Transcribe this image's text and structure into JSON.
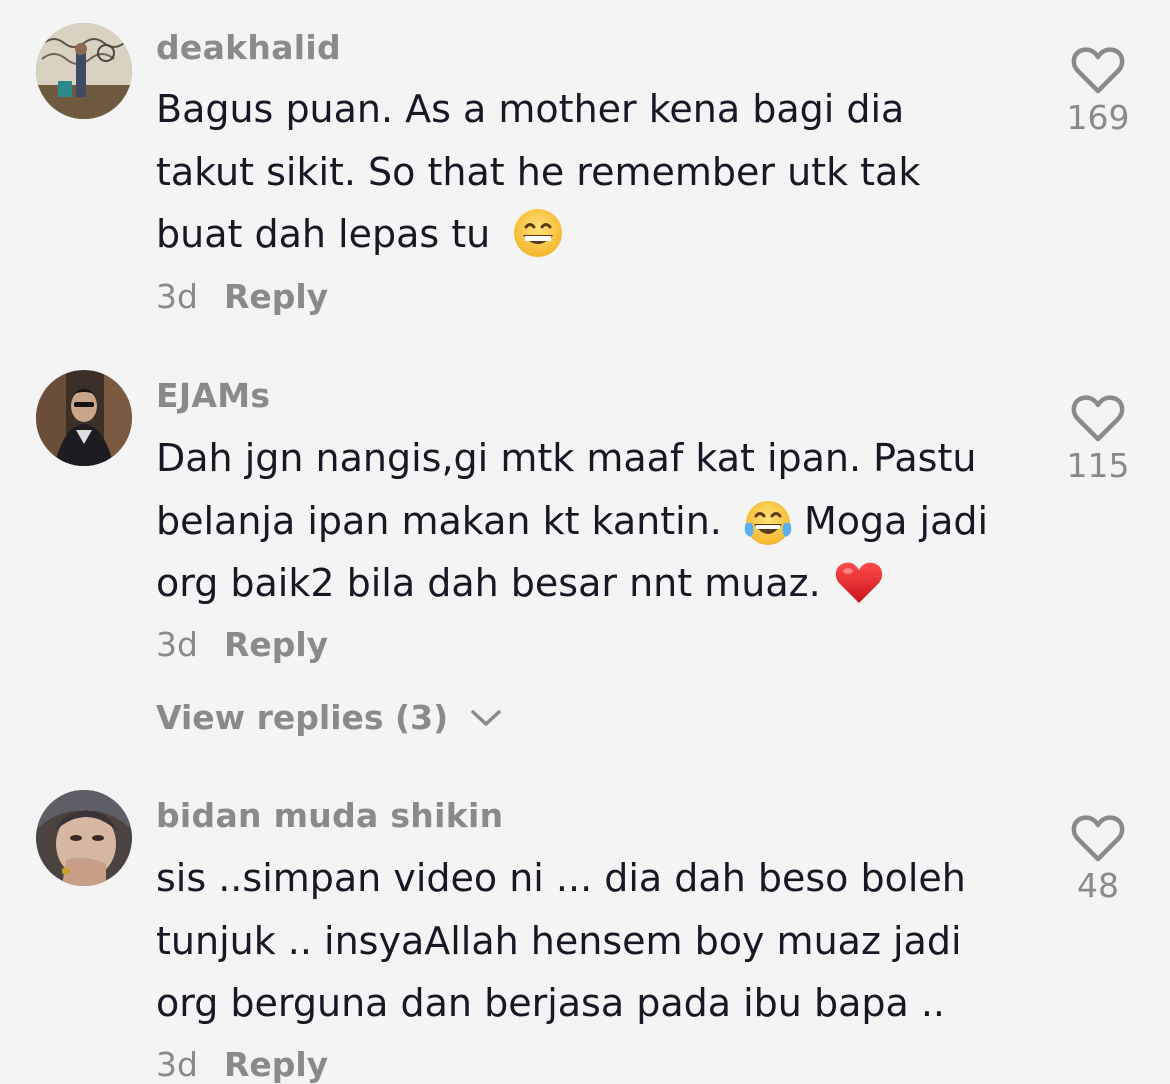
{
  "comments": [
    {
      "username": "deakhalid",
      "lines": [
        "Bagus puan. As a mother kena bagi dia",
        "takut sikit. So that he remember utk tak",
        "buat dah lepas tu"
      ],
      "emoji": "grinning-face",
      "time": "3d",
      "reply_label": "Reply",
      "likes": "169"
    },
    {
      "username": "EJAMs",
      "lines": [
        "Dah jgn nangis,gi mtk maaf kat ipan. Pastu",
        "belanja ipan makan kt kantin.",
        "Moga jadi",
        "org baik2 bila dah besar nnt muaz."
      ],
      "emoji": [
        "tears-of-joy",
        "red-heart"
      ],
      "time": "3d",
      "reply_label": "Reply",
      "likes": "115",
      "view_replies": "View replies (3)"
    },
    {
      "username": "bidan muda shikin",
      "lines": [
        "sis ..simpan video ni ... dia dah beso boleh",
        "tunjuk .. insyaAllah hensem boy muaz jadi",
        "org berguna dan berjasa pada ibu bapa .."
      ],
      "time": "3d",
      "reply_label": "Reply",
      "likes": "48"
    }
  ],
  "colors": {
    "background": "#f4f4f4",
    "text": "#161823",
    "muted": "#8a8a8a"
  }
}
